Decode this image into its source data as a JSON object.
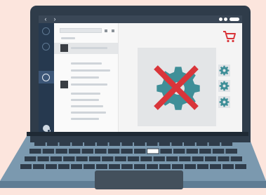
{
  "titlebar": {
    "back_icon": "chevron-left-icon",
    "forward_icon": "chevron-right-icon",
    "back_glyph": "‹",
    "forward_glyph": "›"
  },
  "sidebar": {
    "items": [
      {
        "icon": "circle-icon",
        "active": false
      },
      {
        "icon": "circle-icon",
        "active": false
      },
      {
        "icon": "circle-icon",
        "active": true
      }
    ],
    "bottom_icon": "user-avatar-icon"
  },
  "detail": {
    "image_icon": "gear-icon",
    "overlay_icon": "red-x-cross-icon",
    "cart_icon": "shopping-cart-icon",
    "side_buttons": [
      "gear-icon",
      "gear-icon",
      "gear-icon"
    ]
  },
  "colors": {
    "background": "#fce5dd",
    "laptop_frame": "#2f3c4a",
    "sidebar": "#26394f",
    "gear": "#3f8f98",
    "cross": "#d9353a",
    "cart": "#d9353a",
    "keyboard": "#7b99af",
    "keys": "#2f3c4a"
  }
}
